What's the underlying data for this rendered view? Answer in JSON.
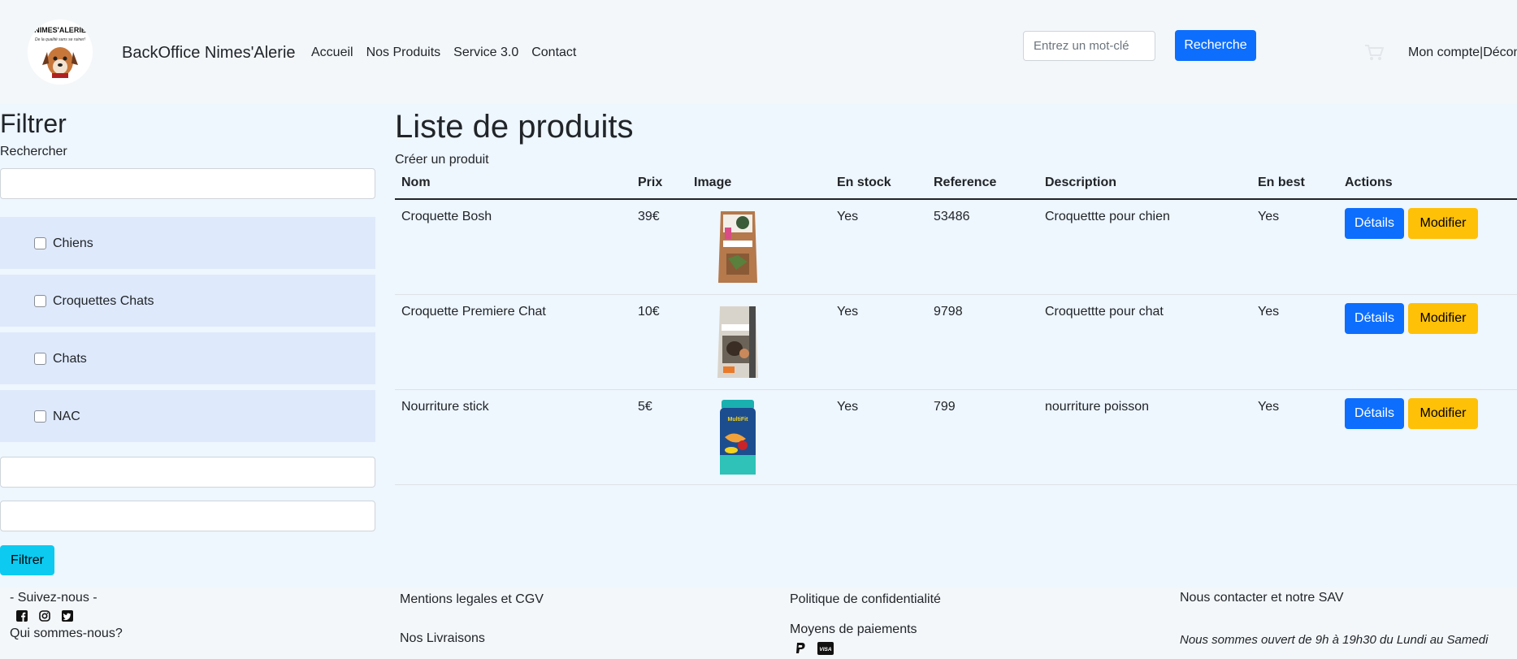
{
  "header": {
    "logo_text": "NIMES'ALERIE",
    "logo_tagline": "De la qualité sans se ruiner!",
    "brand": "BackOffice Nimes'Alerie",
    "nav": [
      "Accueil",
      "Nos Produits",
      "Service 3.0",
      "Contact"
    ],
    "search_placeholder": "Entrez un mot-clé",
    "search_button": "Recherche",
    "cart_icon": "cart-icon",
    "account": "Mon compte|Déconnexion"
  },
  "sidebar": {
    "title": "Filtrer",
    "search_label": "Rechercher",
    "categories": [
      "Chiens",
      "Croquettes Chats",
      "Chats",
      "NAC"
    ],
    "filter_button": "Filtrer"
  },
  "main": {
    "title": "Liste de produits",
    "create_link": "Créer un produit",
    "columns": [
      "Nom",
      "Prix",
      "Image",
      "En stock",
      "Reference",
      "Description",
      "En best",
      "Actions"
    ],
    "rows": [
      {
        "nom": "Croquette Bosh",
        "prix": "39€",
        "stock": "Yes",
        "reference": "53486",
        "description": "Croquettte pour chien",
        "best": "Yes"
      },
      {
        "nom": "Croquette Premiere Chat",
        "prix": "10€",
        "stock": "Yes",
        "reference": "9798",
        "description": "Croquettte pour chat",
        "best": "Yes"
      },
      {
        "nom": "Nourriture stick",
        "prix": "5€",
        "stock": "Yes",
        "reference": "799",
        "description": "nourriture poisson",
        "best": "Yes"
      }
    ],
    "details_label": "Détails",
    "edit_label": "Modifier"
  },
  "footer": {
    "follow": "- Suivez-nous -",
    "about": "Qui sommes-nous?",
    "legal": "Mentions legales et CGV",
    "delivery": "Nos Livraisons",
    "privacy": "Politique de confidentialité",
    "payments": "Moyens de paiements",
    "contact": "Nous contacter et notre SAV",
    "hours": "Nous sommes ouvert de 9h à 19h30 du Lundi au Samedi",
    "social_icons": [
      "facebook-icon",
      "instagram-icon",
      "twitter-icon"
    ],
    "payment_icons": [
      "paypal-icon",
      "visa-icon"
    ]
  },
  "colors": {
    "primary": "#0d6efd",
    "warning": "#ffc107",
    "info": "#0dcaf0",
    "content_bg": "#eef6fe",
    "category_bg": "#dee9fb"
  }
}
